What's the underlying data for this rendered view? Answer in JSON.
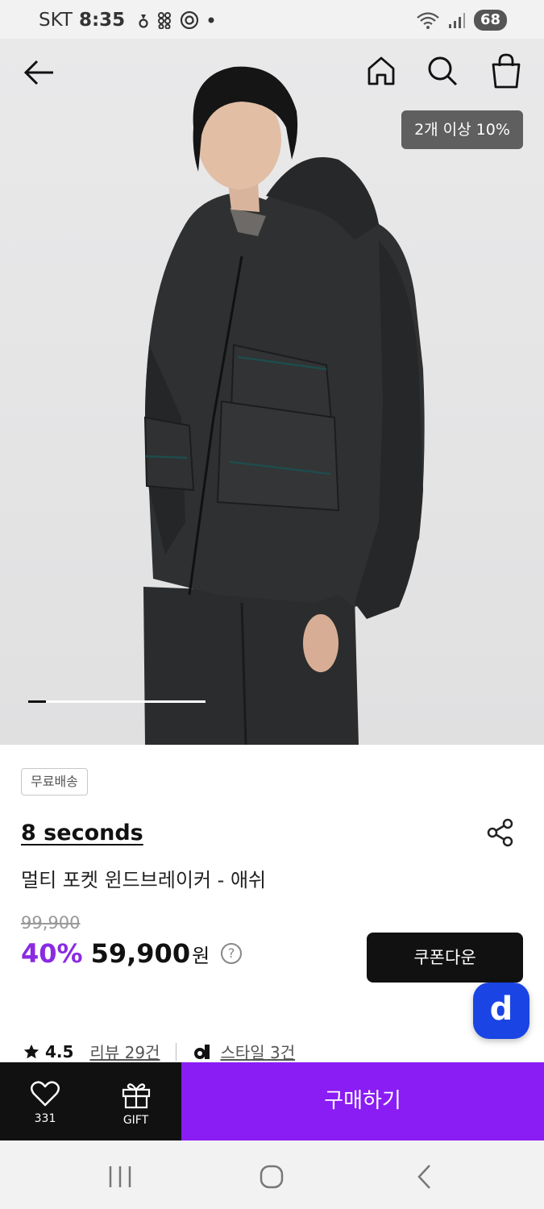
{
  "status": {
    "carrier": "SKT",
    "time": "8:35",
    "battery": "68"
  },
  "hero": {
    "discount_badge": "2개 이상 10%",
    "image_progress": 0.1
  },
  "product": {
    "free_shipping": "무료배송",
    "brand": "8 seconds",
    "name": "멀티 포켓 윈드브레이커 - 애쉬",
    "original_price": "99,900",
    "discount_rate": "40%",
    "sale_price": "59,900",
    "currency": "원",
    "help": "?",
    "coupon_button": "쿠폰다운",
    "fab_letter": "d"
  },
  "stats": {
    "rating": "4.5",
    "reviews": "리뷰 29건",
    "styles": "스타일 3건"
  },
  "bottom_bar": {
    "wish_count": "331",
    "gift_label": "GIFT",
    "buy_label": "구매하기"
  },
  "colors": {
    "accent_purple": "#8a1cf4",
    "discount_purple": "#8a2be2",
    "fab_blue": "#1a44e4"
  }
}
